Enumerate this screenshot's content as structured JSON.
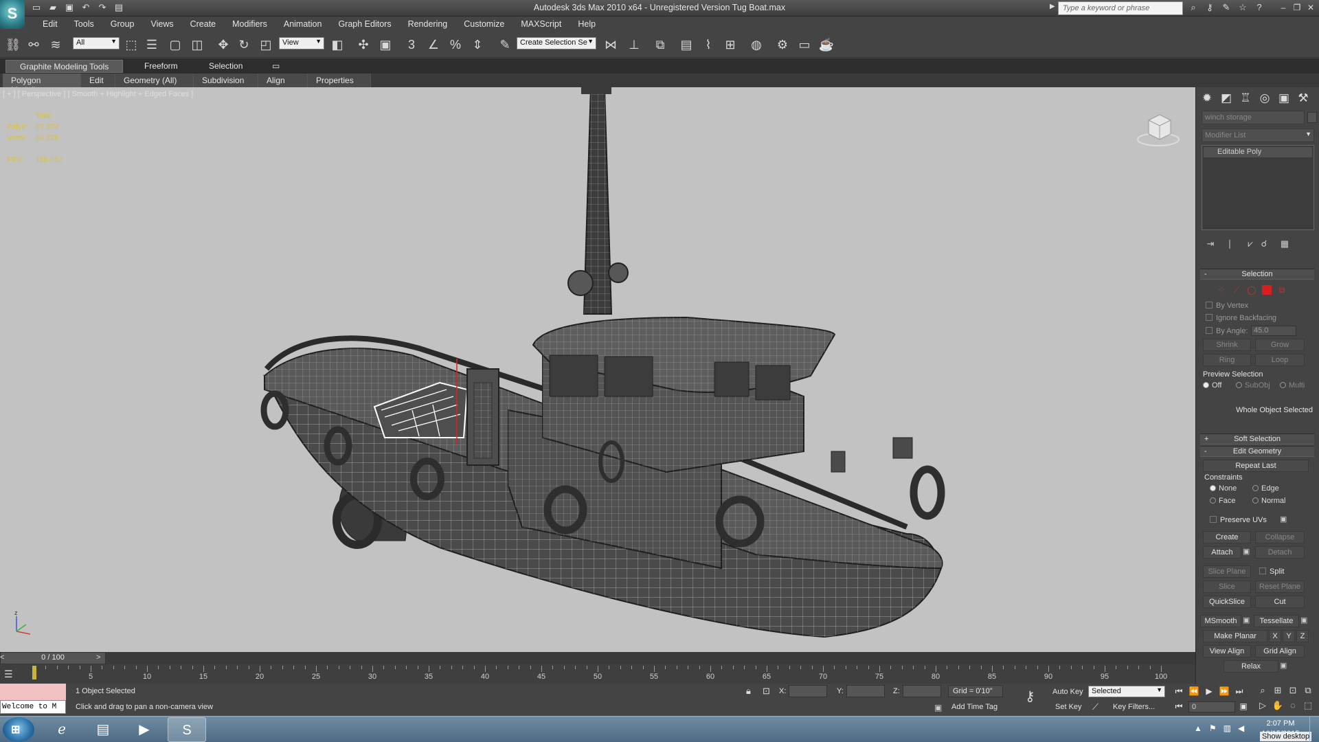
{
  "window": {
    "title": "Autodesk 3ds Max 2010 x64 - Unregistered Version   Tug Boat.max",
    "search_placeholder": "Type a keyword or phrase"
  },
  "menu": [
    "Edit",
    "Tools",
    "Group",
    "Views",
    "Create",
    "Modifiers",
    "Animation",
    "Graph Editors",
    "Rendering",
    "Customize",
    "MAXScript",
    "Help"
  ],
  "toolbar": {
    "selection_filter": "All",
    "ref_coord": "View",
    "named_selection": "Create Selection Se"
  },
  "ribbon": {
    "tabs": [
      "Graphite Modeling Tools",
      "Freeform",
      "Selection"
    ],
    "panels": [
      "Polygon Modeling",
      "Edit",
      "Geometry (All)",
      "Subdivision",
      "Align",
      "Properties"
    ]
  },
  "viewport": {
    "label": "[ + ] [ Perspective ] [ Smooth + Highlight + Edged Faces ]",
    "stats": {
      "total_label": "Total",
      "polys_label": "Polys:",
      "polys": "67,374",
      "verts_label": "Verts:",
      "verts": "66,220",
      "fps_label": "FPS:",
      "fps": "110.852"
    },
    "axis_label": "z"
  },
  "command_panel": {
    "object_name": "winch storage",
    "modifier_list": "Modifier List",
    "stack": [
      "Editable Poly"
    ],
    "selection": {
      "title": "Selection",
      "by_vertex": "By Vertex",
      "ignore_backfacing": "Ignore Backfacing",
      "by_angle": "By Angle:",
      "angle_value": "45.0",
      "shrink": "Shrink",
      "grow": "Grow",
      "ring": "Ring",
      "loop": "Loop",
      "preview_selection": "Preview Selection",
      "preview_off": "Off",
      "preview_subobj": "SubObj",
      "preview_multi": "Multi",
      "whole_object": "Whole Object Selected"
    },
    "soft_selection": "Soft Selection",
    "edit_geometry": {
      "title": "Edit Geometry",
      "repeat_last": "Repeat Last",
      "constraints": "Constraints",
      "none": "None",
      "edge": "Edge",
      "face": "Face",
      "normal": "Normal",
      "preserve_uvs": "Preserve UVs",
      "create": "Create",
      "collapse": "Collapse",
      "attach": "Attach",
      "detach": "Detach",
      "slice_plane": "Slice Plane",
      "split": "Split",
      "slice": "Slice",
      "reset_plane": "Reset Plane",
      "quickslice": "QuickSlice",
      "cut": "Cut",
      "msmooth": "MSmooth",
      "tessellate": "Tessellate",
      "make_planar": "Make Planar",
      "x": "X",
      "y": "Y",
      "z": "Z",
      "view_align": "View Align",
      "grid_align": "Grid Align",
      "relax": "Relax"
    }
  },
  "timeline": {
    "slider_label": "0 / 100",
    "ticks": [
      5,
      10,
      15,
      20,
      25,
      30,
      35,
      40,
      45,
      50,
      55,
      60,
      65,
      70,
      75,
      80,
      85,
      90,
      95,
      100
    ]
  },
  "status": {
    "listener": "Welcome to M",
    "selection_count": "1 Object Selected",
    "prompt": "Click and drag to pan a non-camera view",
    "x_label": "X:",
    "y_label": "Y:",
    "z_label": "Z:",
    "grid": "Grid = 0'10\"",
    "add_time_tag": "Add Time Tag",
    "auto_key": "Auto Key",
    "set_key": "Set Key",
    "key_mode": "Selected",
    "key_filters": "Key Filters...",
    "frame": "0"
  },
  "taskbar": {
    "time": "2:07 PM",
    "date": "10/15/2015",
    "show_desktop": "Show desktop"
  }
}
